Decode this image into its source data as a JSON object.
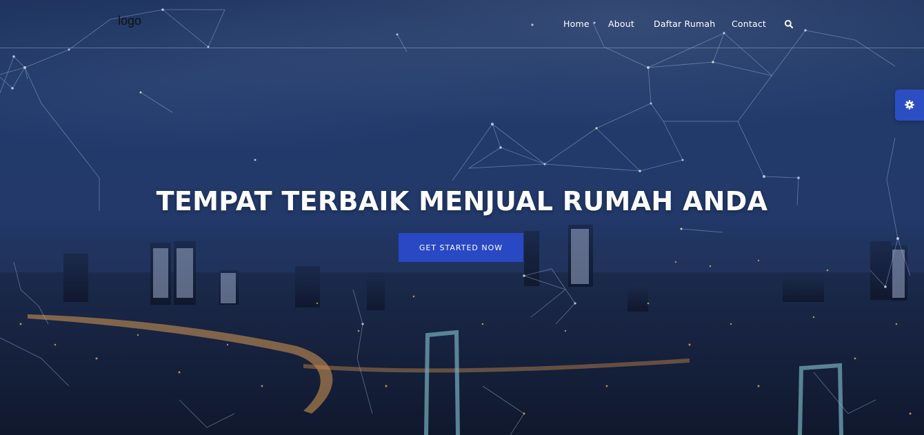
{
  "header": {
    "logo_text": "logo",
    "nav": [
      {
        "label": "Home"
      },
      {
        "label": "About"
      },
      {
        "label": "Daftar Rumah"
      },
      {
        "label": "Contact"
      }
    ],
    "search_icon": "search-icon"
  },
  "hero": {
    "headline": "TEMPAT TERBAIK MENJUAL RUMAH ANDA",
    "cta_label": "GET STARTED NOW"
  },
  "settings": {
    "icon": "gear-icon"
  },
  "colors": {
    "accent": "#2848c4",
    "settings_tab": "#2b4fc2",
    "sky_top": "#1f3560",
    "city_bottom": "#121a31",
    "nav_text": "#ffffff",
    "divider": "#a0b9e1"
  }
}
